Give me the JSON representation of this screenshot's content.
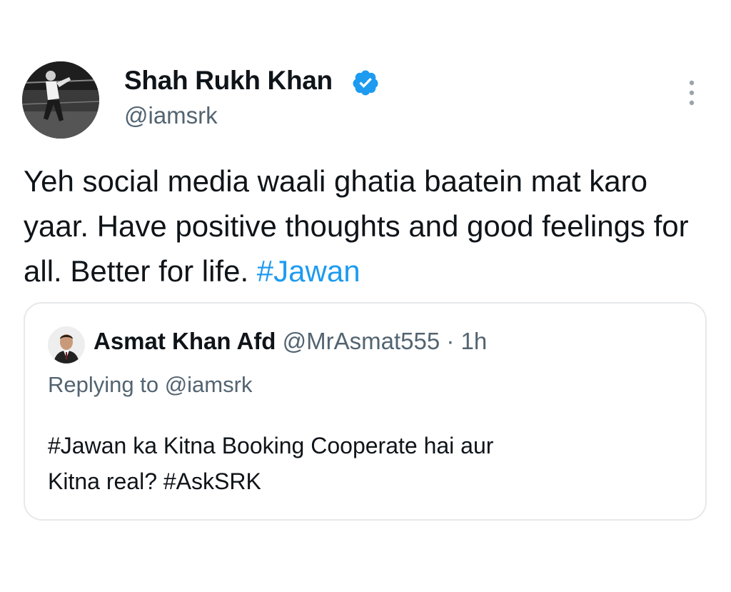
{
  "tweet": {
    "author": {
      "display_name": "Shah Rukh Khan",
      "handle": "@iamsrk",
      "verified": true,
      "avatar_icon": "profile-photo"
    },
    "more_icon": "more-vertical-icon",
    "text": "Yeh social media waali ghatia baatein mat karo yaar. Have positive thoughts and good feelings for all. Better for life. ",
    "hashtag": "#Jawan"
  },
  "quoted_tweet": {
    "author": {
      "display_name": "Asmat Khan Afd",
      "handle": "@MrAsmat555",
      "separator": " · ",
      "time": "1h",
      "avatar_icon": "profile-photo"
    },
    "replying_to": "Replying to @iamsrk",
    "text_line1": "#Jawan ka Kitna Booking Cooperate hai aur",
    "text_line2": "Kitna real? #AskSRK"
  },
  "colors": {
    "link": "#1d9bf0",
    "secondary_text": "#536471",
    "primary_text": "#0f1419",
    "border": "#e6e8ea"
  }
}
